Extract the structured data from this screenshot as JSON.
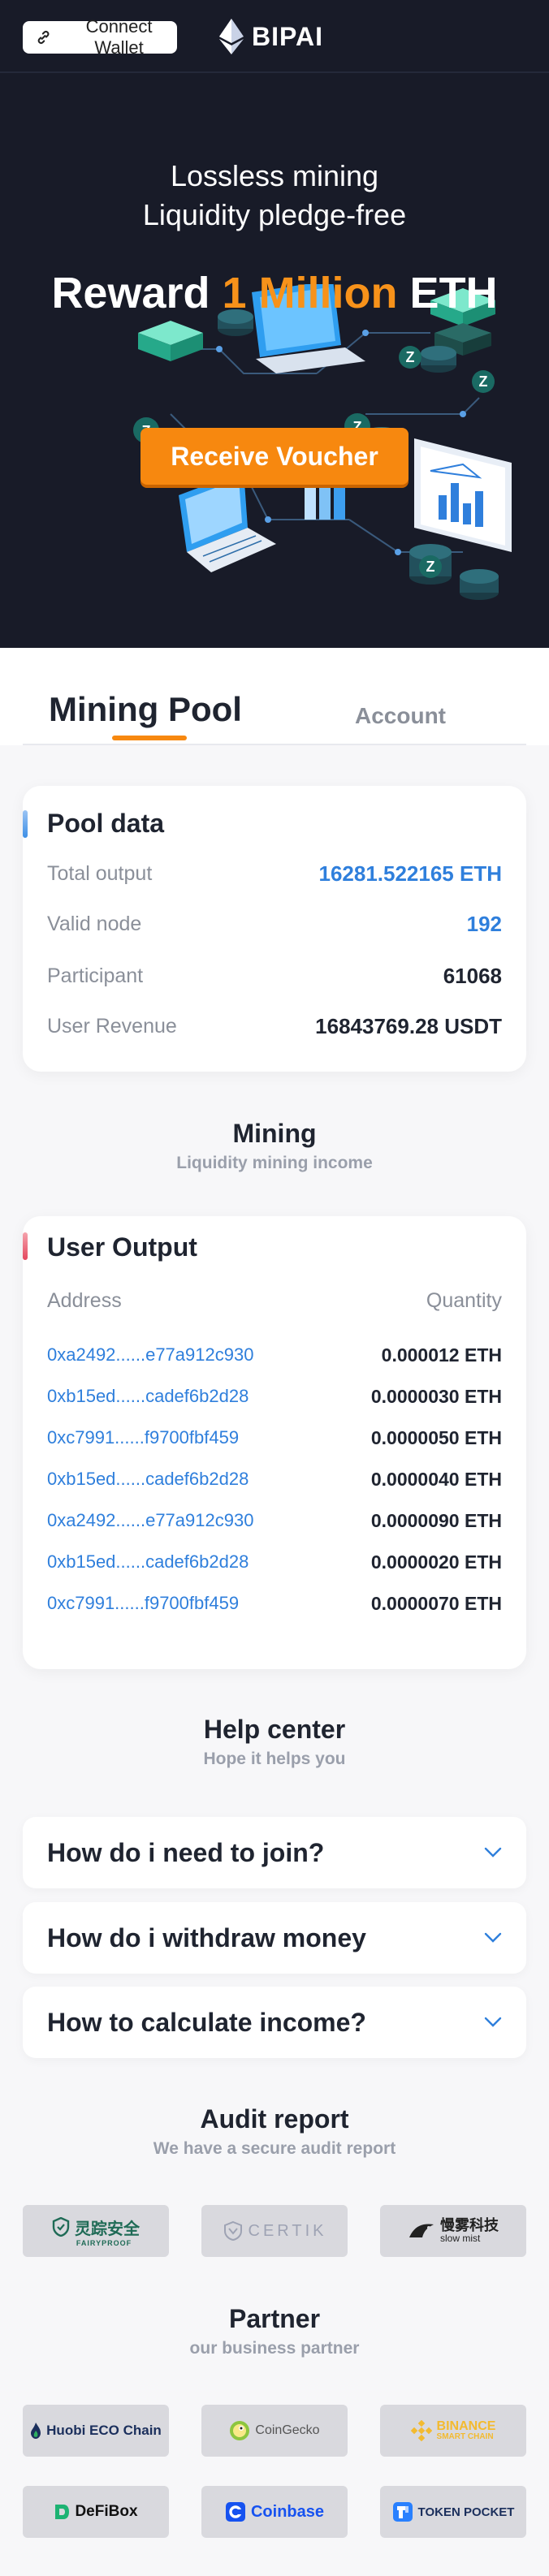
{
  "header": {
    "connect_label": "Connect Wallet",
    "brand": "BIPAI"
  },
  "hero": {
    "line1": "Lossless mining",
    "line2": "Liquidity pledge-free",
    "title_pre": "Reward",
    "title_accent": "1 Million",
    "title_post": "ETH",
    "button_label": "Receive Voucher",
    "accent_color": "#f7880f"
  },
  "tabs": {
    "mining": "Mining Pool",
    "account": "Account"
  },
  "pool": {
    "title": "Pool data",
    "rows": [
      {
        "label": "Total output",
        "value": "16281.522165 ETH"
      },
      {
        "label": "Valid node",
        "value": "192"
      },
      {
        "label": "Participant",
        "value": "61068"
      },
      {
        "label": "User Revenue",
        "value": "16843769.28 USDT"
      }
    ]
  },
  "mining": {
    "title": "Mining",
    "subtitle": "Liquidity mining income"
  },
  "output": {
    "title": "User Output",
    "col_address": "Address",
    "col_quantity": "Quantity",
    "rows": [
      {
        "address": "0xa2492......e77a912c930",
        "qty": "0.000012 ETH"
      },
      {
        "address": "0xb15ed......cadef6b2d28",
        "qty": "0.0000030 ETH"
      },
      {
        "address": "0xc7991......f9700fbf459",
        "qty": "0.0000050 ETH"
      },
      {
        "address": "0xb15ed......cadef6b2d28",
        "qty": "0.0000040 ETH"
      },
      {
        "address": "0xa2492......e77a912c930",
        "qty": "0.0000090 ETH"
      },
      {
        "address": "0xb15ed......cadef6b2d28",
        "qty": "0.0000020 ETH"
      },
      {
        "address": "0xc7991......f9700fbf459",
        "qty": "0.0000070 ETH"
      }
    ]
  },
  "help": {
    "title": "Help center",
    "subtitle": "Hope it helps you",
    "faqs": [
      "How do i need to join?",
      "How do i withdraw money",
      "How to calculate income?"
    ]
  },
  "audit": {
    "title": "Audit report",
    "subtitle": "We have a secure audit report",
    "logos": [
      {
        "name": "灵踪安全",
        "sub": "FAIRYPROOF"
      },
      {
        "name": "CERTIK"
      },
      {
        "name": "慢雾科技",
        "sub": "slow mist"
      }
    ]
  },
  "partner": {
    "title": "Partner",
    "subtitle": "our business partner",
    "logos": [
      {
        "name": "Huobi ECO Chain"
      },
      {
        "name": "CoinGecko"
      },
      {
        "name": "BINANCE",
        "sub": "SMART CHAIN"
      },
      {
        "name": "DeFiBox"
      },
      {
        "name": "Coinbase"
      },
      {
        "name": "TOKEN POCKET"
      }
    ]
  },
  "colors": {
    "hero_bg": "#181b28",
    "link_blue": "#2f7fdc",
    "accent": "#f7880f"
  }
}
